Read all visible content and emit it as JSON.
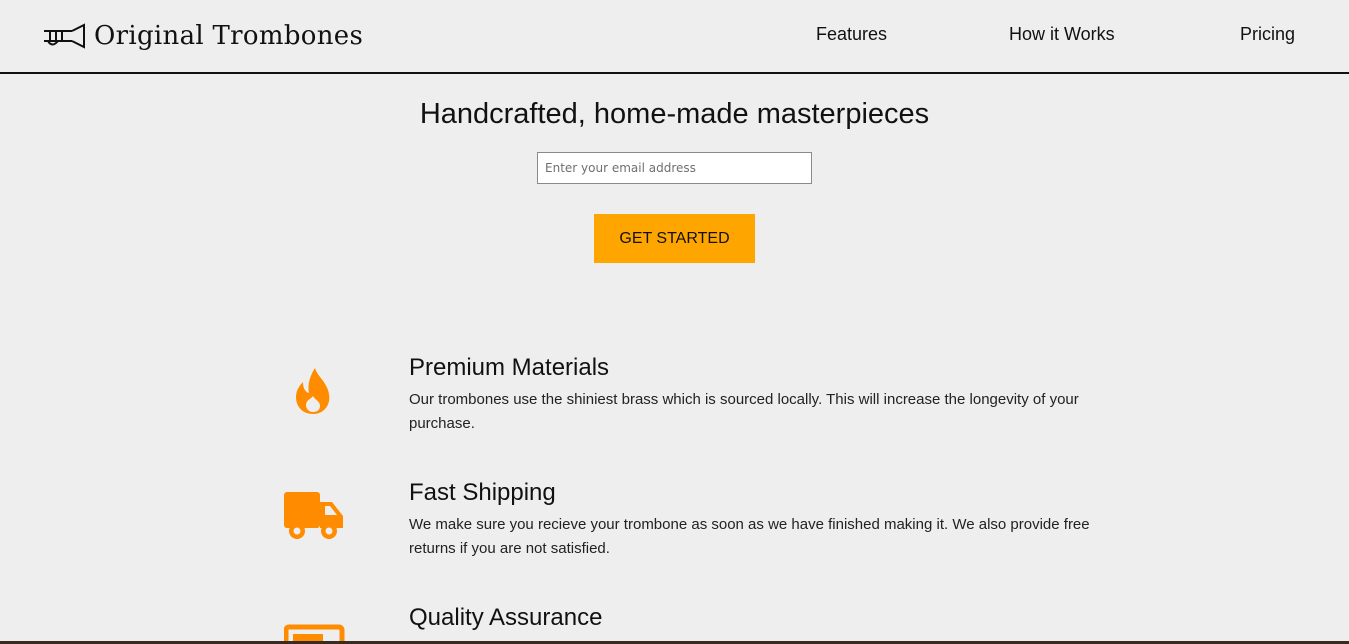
{
  "header": {
    "logo_text": "Original Trombones",
    "nav": [
      {
        "label": "Features"
      },
      {
        "label": "How it Works"
      },
      {
        "label": "Pricing"
      }
    ]
  },
  "hero": {
    "title": "Handcrafted, home-made masterpieces",
    "email_placeholder": "Enter your email address",
    "cta_label": "GET STARTED"
  },
  "features": [
    {
      "icon": "fire-icon",
      "title": "Premium Materials",
      "description": "Our trombones use the shiniest brass which is sourced locally. This will increase the longevity of your purchase."
    },
    {
      "icon": "truck-icon",
      "title": "Fast Shipping",
      "description": "We make sure you recieve your trombone as soon as we have finished making it. We also provide free returns if you are not satisfied."
    },
    {
      "icon": "battery-icon",
      "title": "Quality Assurance",
      "description": ""
    }
  ],
  "colors": {
    "background": "#eeeeee",
    "accent": "#ffa500",
    "icon": "#ff8c00"
  }
}
